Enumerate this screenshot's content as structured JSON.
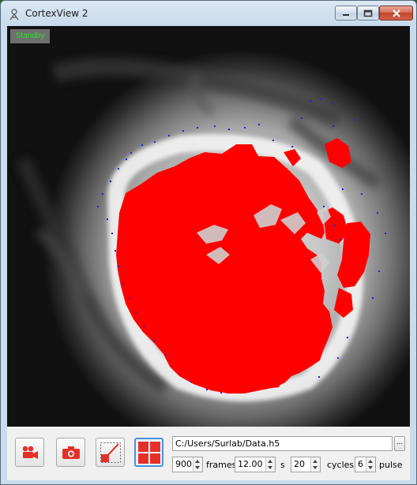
{
  "window": {
    "title": "CortexView 2"
  },
  "viewer": {
    "status_badge": "Standby",
    "overlay_color": "#ff0000",
    "marker_color": "#1a24d8"
  },
  "controls": {
    "record_icon": "video-camera-icon",
    "snapshot_icon": "camera-icon",
    "roi_icon": "roi-line-icon",
    "grid_icon": "grid-icon",
    "file_path": "C:/Users/Surlab/Data.h5",
    "browse_label": "...",
    "frames_value": "900",
    "frames_unit": "frames",
    "duration_value": "12.00",
    "duration_unit": "s",
    "cycles_value": "20",
    "cycles_unit": "cycles",
    "pulse_value": "6",
    "pulse_unit": "pulse"
  }
}
